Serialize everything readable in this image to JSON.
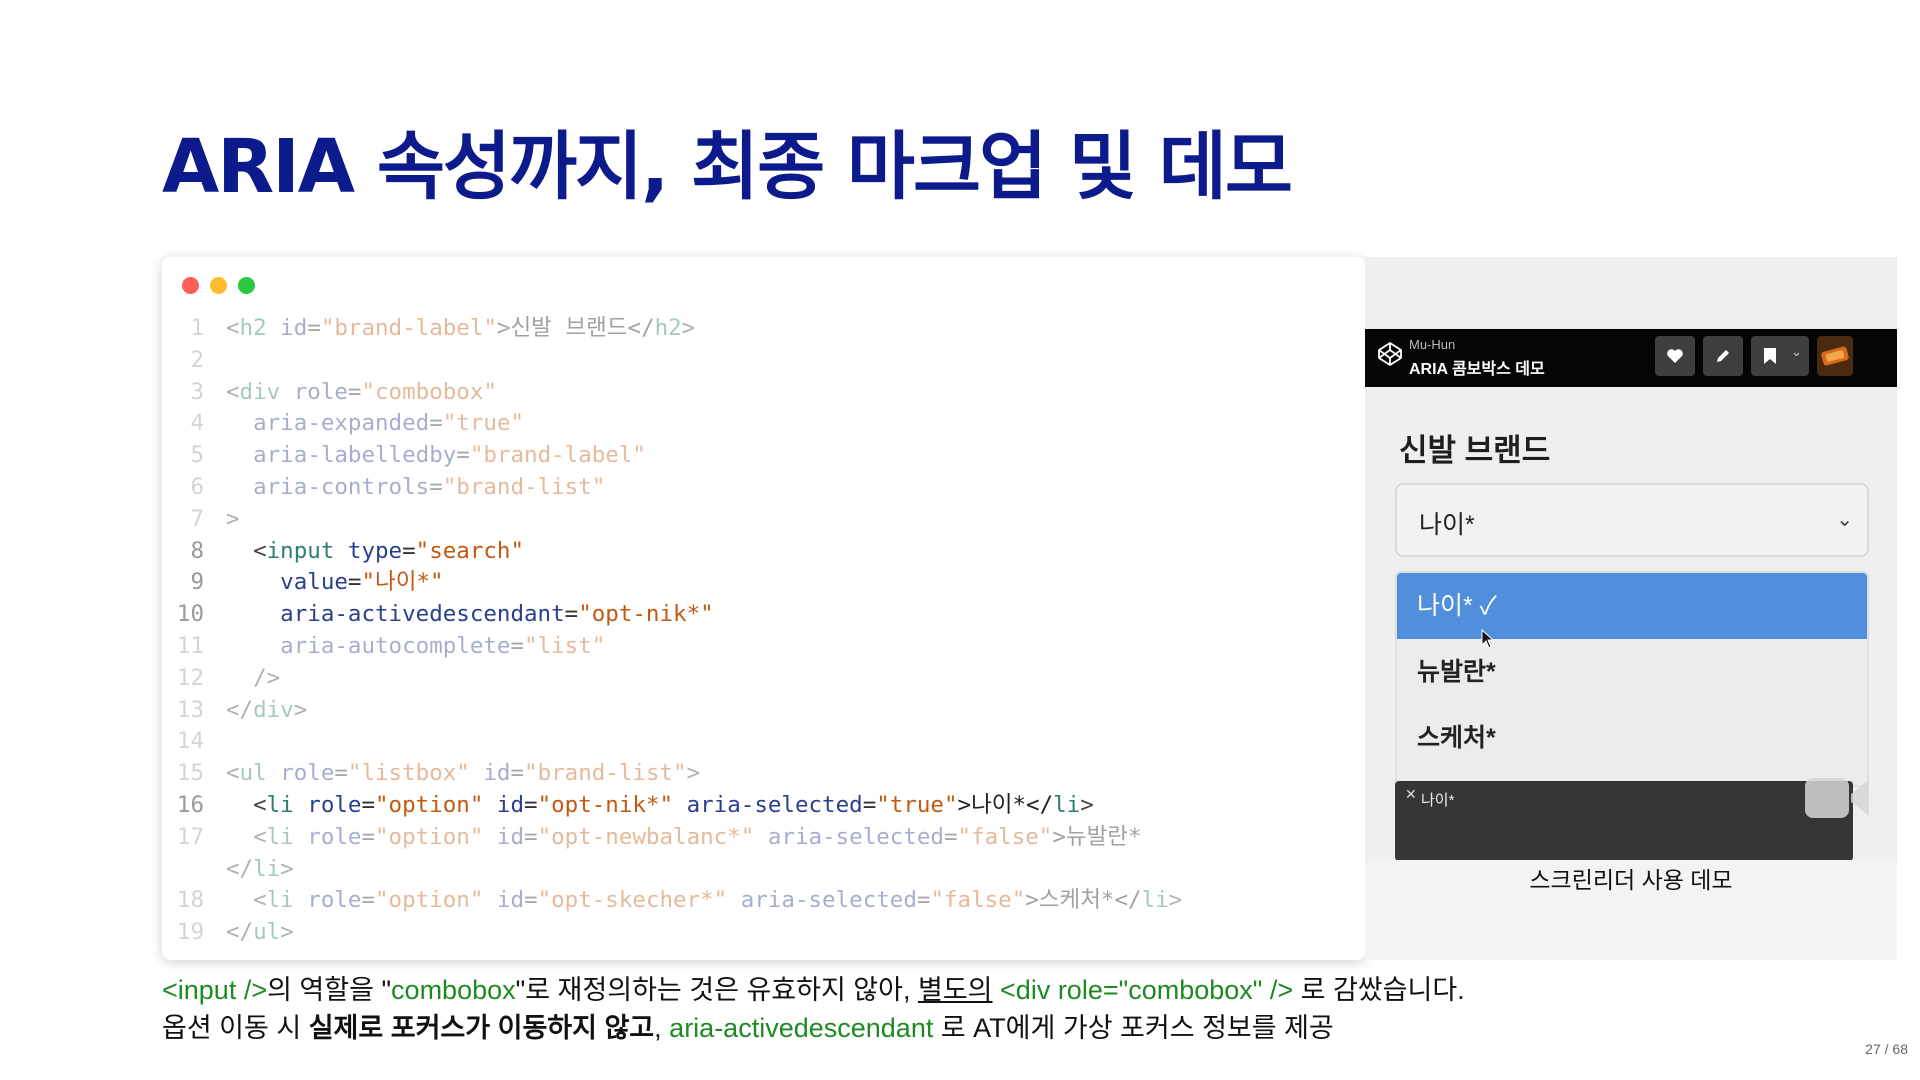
{
  "slide": {
    "title": "ARIA 속성까지, 최종 마크업 및 데모",
    "page_number": "27 / 68"
  },
  "code_window": {
    "dots": [
      "#ff5f57",
      "#febc2e",
      "#28c840"
    ],
    "lines": [
      {
        "num": "1",
        "dim": true,
        "tokens": [
          {
            "t": "<",
            "c": "punct"
          },
          {
            "t": "h2",
            "c": "tag"
          },
          {
            "t": " id",
            "c": "attr"
          },
          {
            "t": "=",
            "c": "eq"
          },
          {
            "t": "\"brand-label\"",
            "c": "str"
          },
          {
            "t": ">신발 브랜드</",
            "c": "txt"
          },
          {
            "t": "h2",
            "c": "tag"
          },
          {
            "t": ">",
            "c": "punct"
          }
        ]
      },
      {
        "num": "2",
        "dim": true,
        "tokens": []
      },
      {
        "num": "3",
        "dim": true,
        "tokens": [
          {
            "t": "<",
            "c": "punct"
          },
          {
            "t": "div",
            "c": "tag"
          },
          {
            "t": " role",
            "c": "attr"
          },
          {
            "t": "=",
            "c": "eq"
          },
          {
            "t": "\"combobox\"",
            "c": "str"
          }
        ]
      },
      {
        "num": "4",
        "dim": true,
        "tokens": [
          {
            "t": "  aria-expanded",
            "c": "attr"
          },
          {
            "t": "=",
            "c": "eq"
          },
          {
            "t": "\"true\"",
            "c": "str"
          }
        ]
      },
      {
        "num": "5",
        "dim": true,
        "tokens": [
          {
            "t": "  aria-labelledby",
            "c": "attr"
          },
          {
            "t": "=",
            "c": "eq"
          },
          {
            "t": "\"brand-label\"",
            "c": "str"
          }
        ]
      },
      {
        "num": "6",
        "dim": true,
        "tokens": [
          {
            "t": "  aria-controls",
            "c": "attr"
          },
          {
            "t": "=",
            "c": "eq"
          },
          {
            "t": "\"brand-list\"",
            "c": "str"
          }
        ]
      },
      {
        "num": "7",
        "dim": true,
        "tokens": [
          {
            "t": ">",
            "c": "punct"
          }
        ]
      },
      {
        "num": "8",
        "dim": false,
        "tokens": [
          {
            "t": "  <",
            "c": "punct"
          },
          {
            "t": "input",
            "c": "tag"
          },
          {
            "t": " type",
            "c": "attr"
          },
          {
            "t": "=",
            "c": "eq"
          },
          {
            "t": "\"search\"",
            "c": "str"
          }
        ]
      },
      {
        "num": "9",
        "dim": false,
        "tokens": [
          {
            "t": "    value",
            "c": "attr"
          },
          {
            "t": "=",
            "c": "eq"
          },
          {
            "t": "\"나이*\"",
            "c": "str"
          }
        ]
      },
      {
        "num": "10",
        "dim": false,
        "tokens": [
          {
            "t": "    aria-activedescendant",
            "c": "attr"
          },
          {
            "t": "=",
            "c": "eq"
          },
          {
            "t": "\"opt-nik*\"",
            "c": "str"
          }
        ]
      },
      {
        "num": "11",
        "dim": true,
        "tokens": [
          {
            "t": "    aria-autocomplete",
            "c": "attr"
          },
          {
            "t": "=",
            "c": "eq"
          },
          {
            "t": "\"list\"",
            "c": "str"
          }
        ]
      },
      {
        "num": "12",
        "dim": true,
        "tokens": [
          {
            "t": "  />",
            "c": "punct"
          }
        ]
      },
      {
        "num": "13",
        "dim": true,
        "tokens": [
          {
            "t": "</",
            "c": "punct"
          },
          {
            "t": "div",
            "c": "tag"
          },
          {
            "t": ">",
            "c": "punct"
          }
        ]
      },
      {
        "num": "14",
        "dim": true,
        "tokens": []
      },
      {
        "num": "15",
        "dim": true,
        "tokens": [
          {
            "t": "<",
            "c": "punct"
          },
          {
            "t": "ul",
            "c": "tag"
          },
          {
            "t": " role",
            "c": "attr"
          },
          {
            "t": "=",
            "c": "eq"
          },
          {
            "t": "\"listbox\"",
            "c": "str"
          },
          {
            "t": " id",
            "c": "attr"
          },
          {
            "t": "=",
            "c": "eq"
          },
          {
            "t": "\"brand-list\"",
            "c": "str"
          },
          {
            "t": ">",
            "c": "punct"
          }
        ]
      },
      {
        "num": "16",
        "dim": false,
        "tokens": [
          {
            "t": "  <",
            "c": "punct"
          },
          {
            "t": "li",
            "c": "tag"
          },
          {
            "t": " role",
            "c": "attr"
          },
          {
            "t": "=",
            "c": "eq"
          },
          {
            "t": "\"option\"",
            "c": "str"
          },
          {
            "t": " id",
            "c": "attr"
          },
          {
            "t": "=",
            "c": "eq"
          },
          {
            "t": "\"opt-nik*\"",
            "c": "str"
          },
          {
            "t": " aria-selected",
            "c": "attr"
          },
          {
            "t": "=",
            "c": "eq"
          },
          {
            "t": "\"true\"",
            "c": "str"
          },
          {
            "t": ">나이*</",
            "c": "txt"
          },
          {
            "t": "li",
            "c": "tag"
          },
          {
            "t": ">",
            "c": "punct"
          }
        ]
      },
      {
        "num": "17",
        "dim": true,
        "tokens": [
          {
            "t": "  <",
            "c": "punct"
          },
          {
            "t": "li",
            "c": "tag"
          },
          {
            "t": " role",
            "c": "attr"
          },
          {
            "t": "=",
            "c": "eq"
          },
          {
            "t": "\"option\"",
            "c": "str"
          },
          {
            "t": " id",
            "c": "attr"
          },
          {
            "t": "=",
            "c": "eq"
          },
          {
            "t": "\"opt-newbalanc*\"",
            "c": "str"
          },
          {
            "t": " aria-selected",
            "c": "attr"
          },
          {
            "t": "=",
            "c": "eq"
          },
          {
            "t": "\"false\"",
            "c": "str"
          },
          {
            "t": ">뉴발란*",
            "c": "txt"
          }
        ]
      },
      {
        "num": "",
        "dim": true,
        "tokens": [
          {
            "t": "</",
            "c": "punct"
          },
          {
            "t": "li",
            "c": "tag"
          },
          {
            "t": ">",
            "c": "punct"
          }
        ]
      },
      {
        "num": "18",
        "dim": true,
        "tokens": [
          {
            "t": "  <",
            "c": "punct"
          },
          {
            "t": "li",
            "c": "tag"
          },
          {
            "t": " role",
            "c": "attr"
          },
          {
            "t": "=",
            "c": "eq"
          },
          {
            "t": "\"option\"",
            "c": "str"
          },
          {
            "t": " id",
            "c": "attr"
          },
          {
            "t": "=",
            "c": "eq"
          },
          {
            "t": "\"opt-skecher*\"",
            "c": "str"
          },
          {
            "t": " aria-selected",
            "c": "attr"
          },
          {
            "t": "=",
            "c": "eq"
          },
          {
            "t": "\"false\"",
            "c": "str"
          },
          {
            "t": ">스케처*</",
            "c": "txt"
          },
          {
            "t": "li",
            "c": "tag"
          },
          {
            "t": ">",
            "c": "punct"
          }
        ]
      },
      {
        "num": "19",
        "dim": true,
        "tokens": [
          {
            "t": "</",
            "c": "punct"
          },
          {
            "t": "ul",
            "c": "tag"
          },
          {
            "t": ">",
            "c": "punct"
          }
        ]
      }
    ]
  },
  "demo": {
    "pen_author": "Mu-Hun",
    "pen_title": "ARIA 콤보박스 데모",
    "heading": "신발 브랜드",
    "combo_value": "나이*",
    "options": [
      {
        "label": "나이* ✓",
        "selected": true
      },
      {
        "label": "뉴발란*",
        "selected": false
      },
      {
        "label": "스케처*",
        "selected": false
      }
    ],
    "screen_reader_text": "나이*",
    "caption": "스크린리더 사용 데모"
  },
  "notes": {
    "line1": {
      "p1": "<input />",
      "p2": "의 역할을 \"",
      "p3": "combobox",
      "p4": "\"로 재정의하는 것은 유효하지 않아, ",
      "p5": "별도의",
      "p6": " ",
      "p7": "<div role=\"combobox\" />",
      "p8": " 로 감쌌습니다."
    },
    "line2": {
      "p1": "옵션 이동 시 ",
      "p2": "실제로 포커스가 이동하지 않고",
      "p3": ", ",
      "p4": "aria-activedescendant",
      "p5": " 로 AT에게 가상 포커스 정보를 제공"
    }
  }
}
